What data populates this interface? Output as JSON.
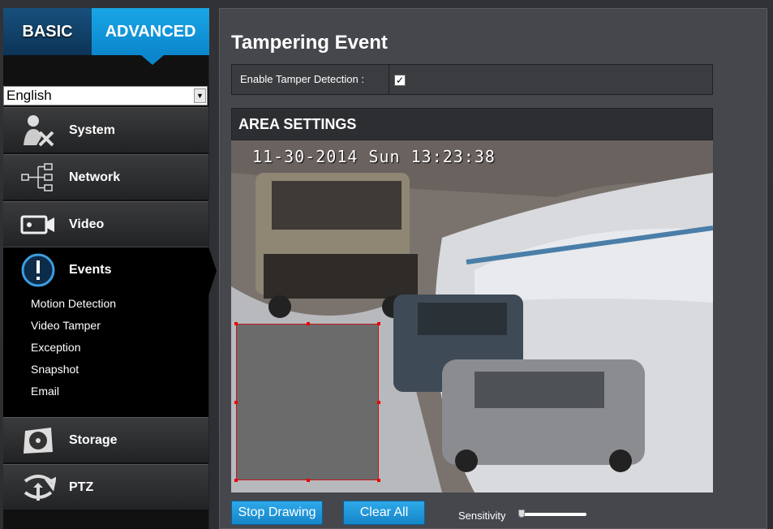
{
  "sidebar": {
    "tabs": {
      "basic": "BASIC",
      "advanced": "ADVANCED"
    },
    "language": "English",
    "items": [
      {
        "label": "System",
        "icon": "system-icon"
      },
      {
        "label": "Network",
        "icon": "network-icon"
      },
      {
        "label": "Video",
        "icon": "video-icon"
      },
      {
        "label": "Events",
        "icon": "events-icon"
      },
      {
        "label": "Storage",
        "icon": "storage-icon"
      },
      {
        "label": "PTZ",
        "icon": "ptz-icon"
      }
    ],
    "event_subitems": [
      "Motion Detection",
      "Video Tamper",
      "Exception",
      "Snapshot",
      "Email"
    ]
  },
  "main": {
    "title": "Tampering Event",
    "enable_label": "Enable Tamper Detection :",
    "enable_checked": "✓",
    "area_title": "AREA SETTINGS",
    "timestamp": "11-30-2014 Sun 13:23:38",
    "stop_button": "Stop Drawing",
    "clear_button": "Clear All",
    "sensitivity_label": "Sensitivity",
    "sensitivity_value": 0
  },
  "colors": {
    "accent": "#1aa6e6",
    "selection_border": "#c0181c"
  }
}
